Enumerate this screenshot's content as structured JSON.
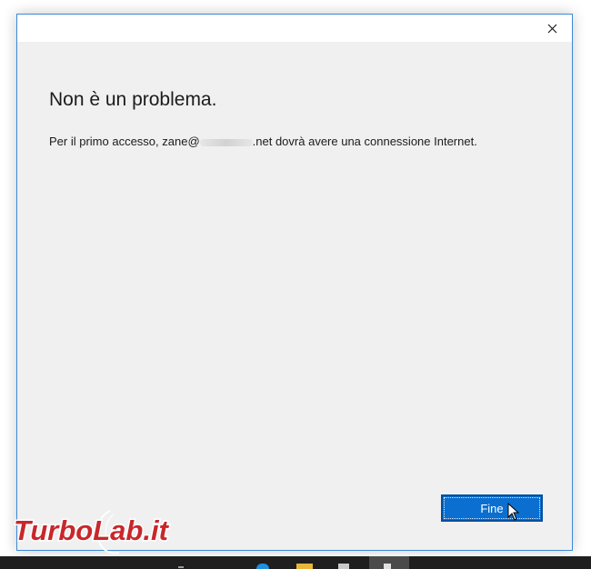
{
  "dialog": {
    "close_icon": "close-icon",
    "heading": "Non è un problema.",
    "message": {
      "prefix": "Per il primo accesso, zane@",
      "suffix": ".net dovrà avere una connessione Internet."
    },
    "finish_button": "Fine"
  },
  "watermark": {
    "text": "TurboLab.it"
  },
  "colors": {
    "accent": "#0a6fd0",
    "dialog_border": "#3b8ad8",
    "watermark": "#c8272b"
  }
}
